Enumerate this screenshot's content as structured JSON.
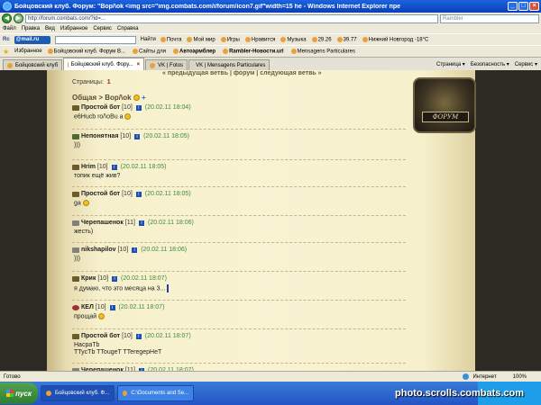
{
  "window": {
    "title": "Бойцовский клуб. Форум: \"Вор/\\ok <img src=\"img.combats.com/i/forum/icon7.gif\"width=15 he - Windows Internet Explorer пре",
    "address": "http://forum.combats.com/?id=...",
    "search_placeholder": "Rambler"
  },
  "menu": [
    "Файл",
    "Правка",
    "Вид",
    "Избранное",
    "Сервис",
    "Справка"
  ],
  "toolbar": {
    "logo": "Rc",
    "mail": "@mail.ru",
    "find_label": "Найти",
    "items": [
      "Почта",
      "Мой мир",
      "Игры",
      "Нравится",
      "Музыка",
      "29.26",
      "39.77",
      "Нижний Новгород -18°C"
    ]
  },
  "favorites": {
    "label": "Избранное",
    "items": [
      {
        "label": "Бойцовский клуб. Форум В...",
        "bold": false
      },
      {
        "label": "Сайты для",
        "bold": false
      },
      {
        "label": "Автоармблер",
        "bold": true
      },
      {
        "label": "Rambler-Новости.url",
        "bold": true
      },
      {
        "label": "Mensagens Particulares",
        "bold": false
      }
    ]
  },
  "tabs": [
    {
      "label": "Бойцовский клуб",
      "active": false
    },
    {
      "label": "Бойцовский клуб. Фору...",
      "active": true
    },
    {
      "label": "VK | Fotos",
      "active": false
    },
    {
      "label": "VK | Mensagens Particulares",
      "active": false
    }
  ],
  "tab_tools": [
    "Страница",
    "Безопасность",
    "Сервис"
  ],
  "forum": {
    "top_links": "« предыдущая ветвь | форум | следующая ветвь »",
    "pages_label": "Страницы:",
    "page_num": "1",
    "breadcrumb": "Общая > Вор/\\ok",
    "emblem": "ФОРУМ",
    "posts": [
      {
        "author": "Простой бот",
        "level": "[10]",
        "date": "(20.02.11 18:04)",
        "text": "е6Hucb ro/\\oBu a",
        "smile": true,
        "icon": "default"
      },
      {
        "author": "Непонятная",
        "level": "[10]",
        "date": "(20.02.11 18:05)",
        "text": ")))",
        "smile": false,
        "icon": "green"
      },
      {
        "author": "Hrim",
        "level": "[10]",
        "date": "(20.02.11 18:05)",
        "text": "топик ещё жив?",
        "smile": false,
        "icon": "default"
      },
      {
        "author": "Простой бот",
        "level": "[10]",
        "date": "(20.02.11 18:05)",
        "text": "ga",
        "smile": true,
        "icon": "default"
      },
      {
        "author": "Черепашенок",
        "level": "[11]",
        "date": "(20.02.11 18:06)",
        "text": "жесть)",
        "smile": false,
        "icon": "gray"
      },
      {
        "author": "nikshapilov",
        "level": "[10]",
        "date": "(20.02.11 18:06)",
        "text": ")))",
        "smile": false,
        "icon": "gray"
      },
      {
        "author": "Крик",
        "level": "[10]",
        "date": "(20.02.11 18:07)",
        "text": "я думаю, что это месяца на 3...",
        "smile": false,
        "icon": "default",
        "cursor": true
      },
      {
        "author": "КЕЛ",
        "level": "[10]",
        "date": "(20.02.11 18:07)",
        "text": "прощай",
        "smile": true,
        "icon": "red"
      },
      {
        "author": "Простой бот",
        "level": "[10]",
        "date": "(20.02.11 18:07)",
        "text": "HacpaTb",
        "text2": "TTycTb TTougeT TTeregepHeT",
        "smile": false,
        "icon": "default"
      },
      {
        "author": "Черепашенок",
        "level": "[11]",
        "date": "(20.02.11 18:07)",
        "text": "",
        "smile": false,
        "icon": "gray"
      }
    ]
  },
  "status": {
    "left": "Готово",
    "zone": "Интернет",
    "zoom": "100%"
  },
  "taskbar": {
    "start": "пуск",
    "buttons": [
      {
        "label": "Бойцовский клуб. Ф...",
        "active": true
      },
      {
        "label": "C:\\Documents and Se...",
        "active": false
      }
    ],
    "watermark": "photo.scrolls.combats.com"
  }
}
